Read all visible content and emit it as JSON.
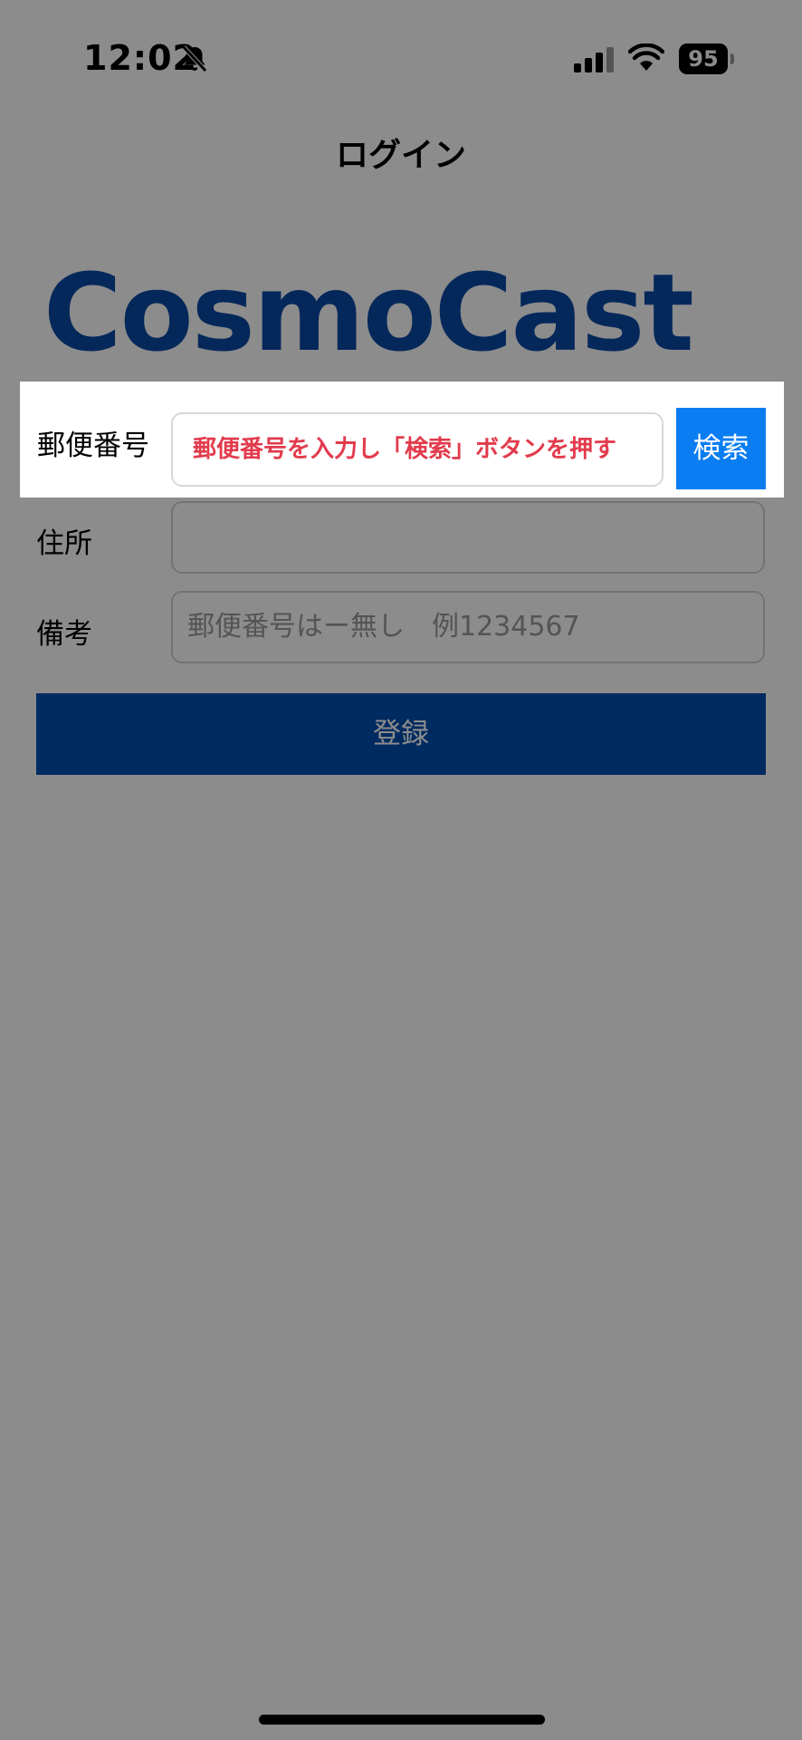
{
  "status_bar": {
    "time": "12:02",
    "battery": "95",
    "icons": [
      "bell-slash-icon",
      "signal-icon",
      "wifi-icon",
      "battery-icon"
    ]
  },
  "nav": {
    "title": "ログイン"
  },
  "logo": {
    "text": "CosmoCast",
    "color": "#0a49a6"
  },
  "form": {
    "postal": {
      "label": "郵便番号",
      "hint": "郵便番号を入力し「検索」ボタンを押す",
      "search_button": "検索"
    },
    "address": {
      "label": "住所",
      "value": ""
    },
    "notes": {
      "label": "備考",
      "placeholder": "郵便番号はー無し　例1234567"
    },
    "register_button": "登録"
  },
  "colors": {
    "search_button": "#0a7df2",
    "register_button": "#004fb0",
    "hint_text": "#e23b4c",
    "overlay": "rgba(0,0,0,0.45)"
  }
}
